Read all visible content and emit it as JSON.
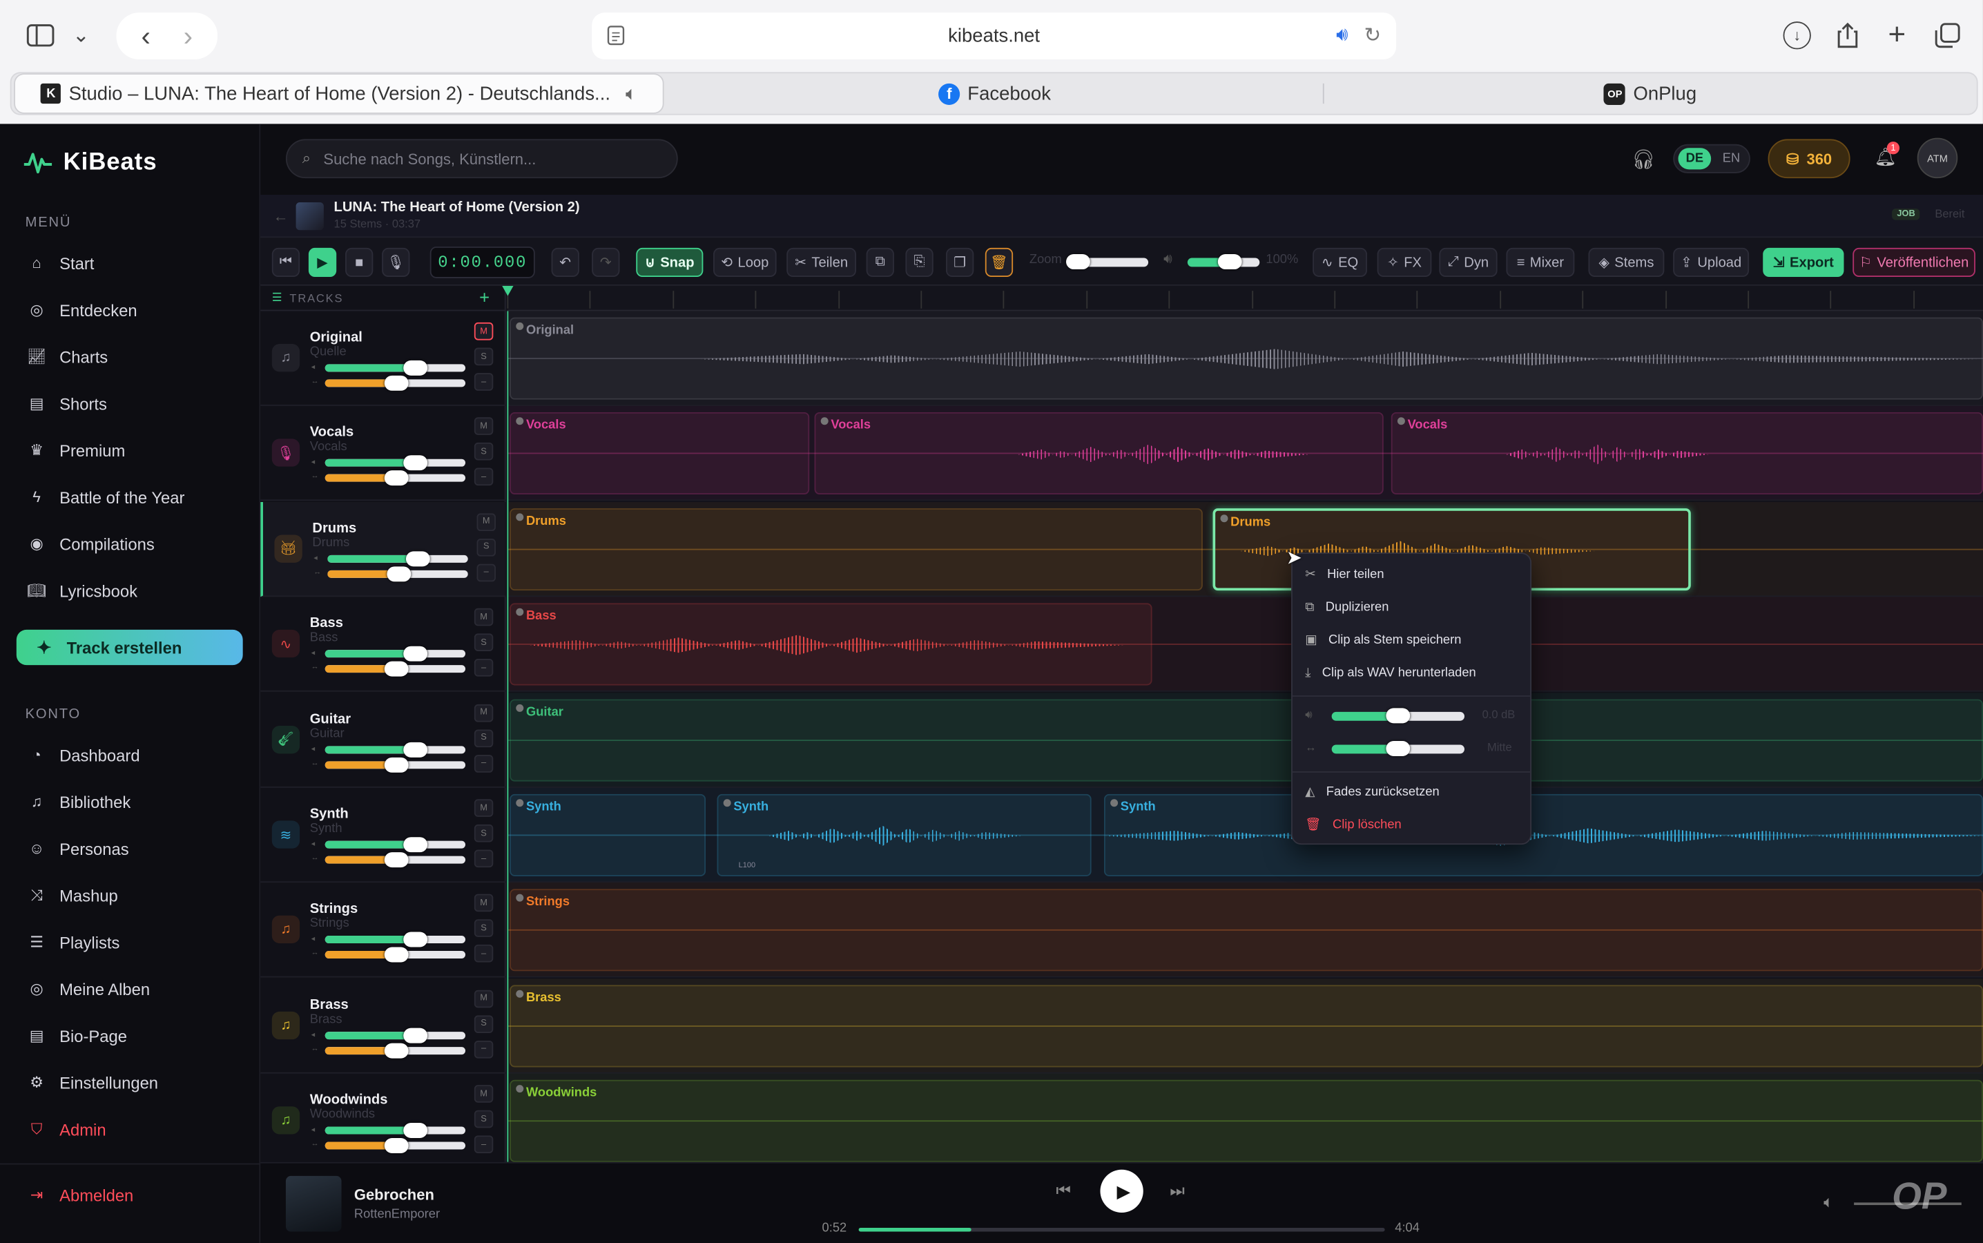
{
  "browser": {
    "url": "kibeats.net",
    "tabs": [
      {
        "label": "Studio – LUNA: The Heart of Home (Version 2) - Deutschlands..."
      },
      {
        "label": "Facebook"
      },
      {
        "label": "OnPlug"
      }
    ]
  },
  "app": {
    "logo": "KiBeats",
    "search_placeholder": "Suche nach Songs, Künstlern...",
    "lang_de": "DE",
    "lang_en": "EN",
    "credits": "360",
    "notifications": "1",
    "avatar_initials": "ATM"
  },
  "sidebar": {
    "menu_label": "MENÜ",
    "menu": [
      "Start",
      "Entdecken",
      "Charts",
      "Shorts",
      "Premium",
      "Battle of the Year",
      "Compilations",
      "Lyricsbook"
    ],
    "create": "Track erstellen",
    "account_label": "KONTO",
    "account": [
      "Dashboard",
      "Bibliothek",
      "Personas",
      "Mashup",
      "Playlists",
      "Meine Alben",
      "Bio-Page",
      "Einstellungen",
      "Admin"
    ],
    "logout": "Abmelden"
  },
  "project": {
    "title": "LUNA: The Heart of Home (Version 2)",
    "meta": "15 Stems · 03:37",
    "job": "JOB",
    "status": "Bereit"
  },
  "toolbar": {
    "time": "0:00.000",
    "snap": "Snap",
    "loop": "Loop",
    "split": "Teilen",
    "zoom": "Zoom",
    "volume_pct": "100%",
    "eq": "EQ",
    "fx": "FX",
    "dyn": "Dyn",
    "mixer": "Mixer",
    "stems": "Stems",
    "upload": "Upload",
    "export": "Export",
    "publish": "Veröffentlichen"
  },
  "tracks_label": "TRACKS",
  "tracks": [
    {
      "name": "Original",
      "sub": "Quelle",
      "color": "#8a8a96",
      "mute": "M",
      "solo": "S"
    },
    {
      "name": "Vocals",
      "sub": "Vocals",
      "color": "#e0409a",
      "mute": "M",
      "solo": "S"
    },
    {
      "name": "Drums",
      "sub": "Drums",
      "color": "#f0a02a",
      "mute": "M",
      "solo": "S"
    },
    {
      "name": "Bass",
      "sub": "Bass",
      "color": "#e84848",
      "mute": "M",
      "solo": "S"
    },
    {
      "name": "Guitar",
      "sub": "Guitar",
      "color": "#3ec07a",
      "mute": "M",
      "solo": "S"
    },
    {
      "name": "Synth",
      "sub": "Synth",
      "color": "#38b0e0",
      "mute": "M",
      "solo": "S"
    },
    {
      "name": "Strings",
      "sub": "Strings",
      "color": "#f07a2a",
      "mute": "M",
      "solo": "S"
    },
    {
      "name": "Brass",
      "sub": "Brass",
      "color": "#e8c030",
      "mute": "M",
      "solo": "S"
    },
    {
      "name": "Woodwinds",
      "sub": "Woodwinds",
      "color": "#8ad038",
      "mute": "M",
      "solo": "S"
    }
  ],
  "clips": {
    "original": "Original",
    "vocals": "Vocals",
    "drums": "Drums",
    "bass": "Bass",
    "guitar": "Guitar",
    "synth": "Synth",
    "strings": "Strings",
    "brass": "Brass",
    "woodwinds": "Woodwinds",
    "fade_label": "L100"
  },
  "context_menu": {
    "split_here": "Hier teilen",
    "duplicate": "Duplizieren",
    "save_stem": "Clip als Stem speichern",
    "download_wav": "Clip als WAV herunterladen",
    "gain": "0.0 dB",
    "pan": "Mitte",
    "reset_fades": "Fades zurücksetzen",
    "delete": "Clip löschen"
  },
  "player": {
    "title": "Gebrochen",
    "artist": "RottenEmporer",
    "elapsed": "0:52",
    "total": "4:04",
    "progress": 0.213
  }
}
